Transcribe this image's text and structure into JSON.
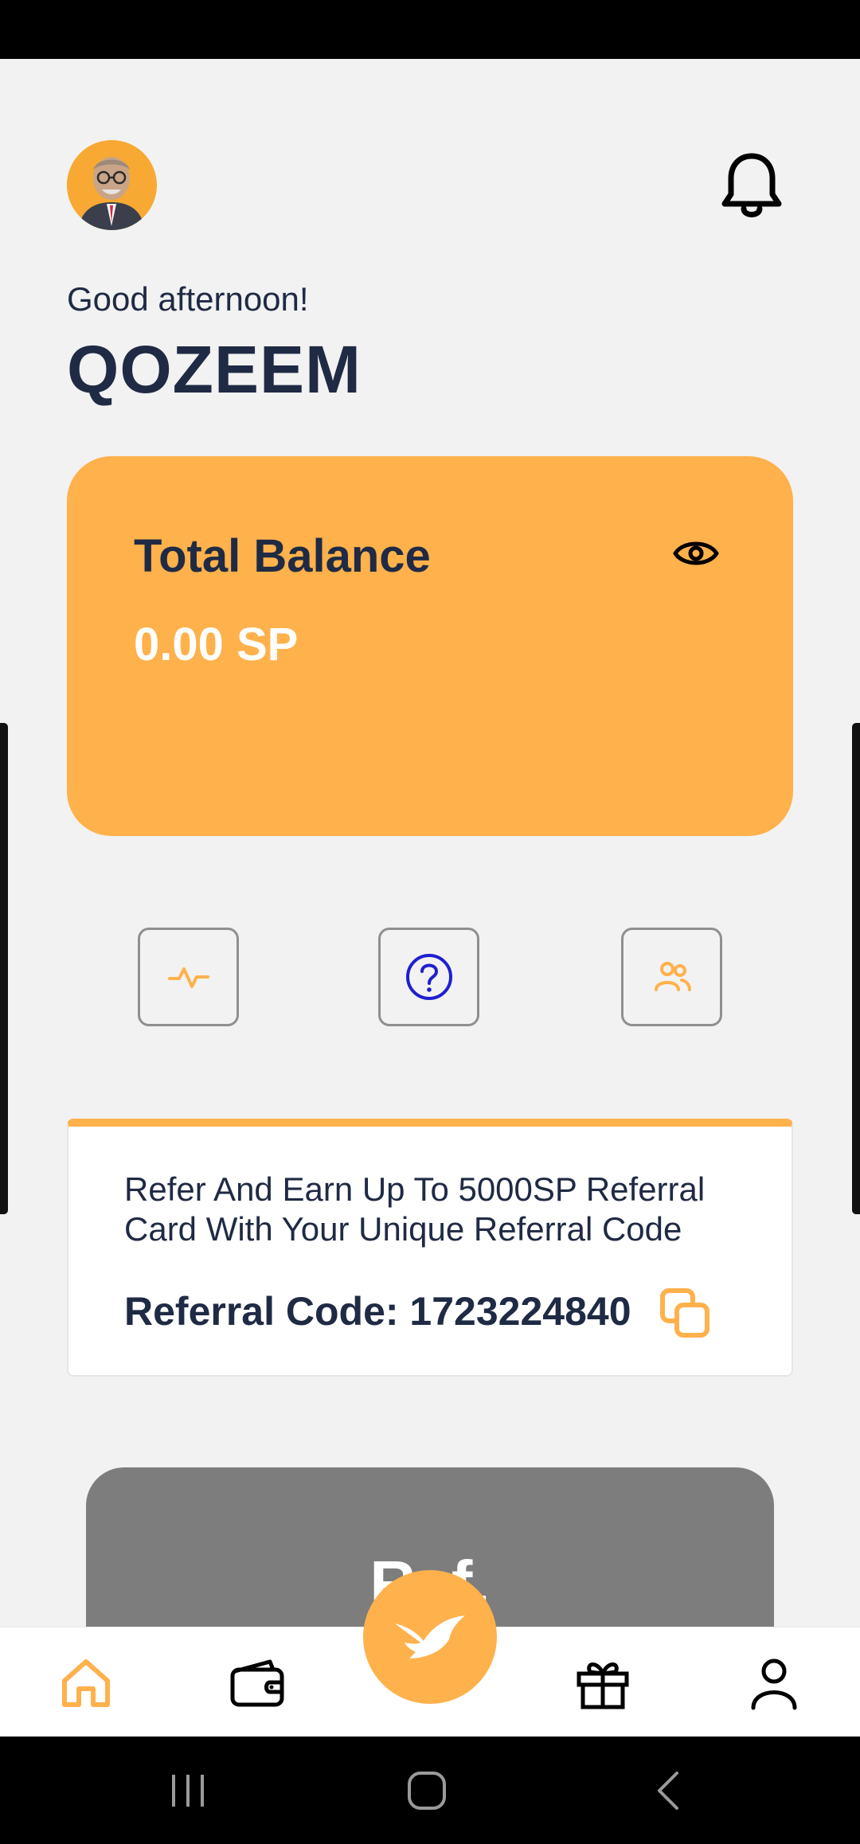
{
  "greeting": "Good afternoon!",
  "username": "QOZEEM",
  "balance": {
    "title": "Total Balance",
    "value": "0.00 SP"
  },
  "quick_actions": [
    {
      "icon": "activity-icon"
    },
    {
      "icon": "help-icon"
    },
    {
      "icon": "users-icon"
    }
  ],
  "referral": {
    "description": "Refer And Earn Up To 5000SP Referral Card With Your Unique Referral Code",
    "code_label": "Referral Code: 1723224840"
  },
  "promo": {
    "text": "Ref."
  },
  "bottom_nav": {
    "items": [
      "home-icon",
      "wallet-icon",
      "bird-icon",
      "gift-icon",
      "user-icon"
    ],
    "active": "home-icon"
  },
  "colors": {
    "accent": "#ffb14b",
    "text_dark": "#1f2a44",
    "background": "#f2f2f2",
    "help_blue": "#1f1fd0",
    "promo_gray": "#7d7d7d"
  }
}
